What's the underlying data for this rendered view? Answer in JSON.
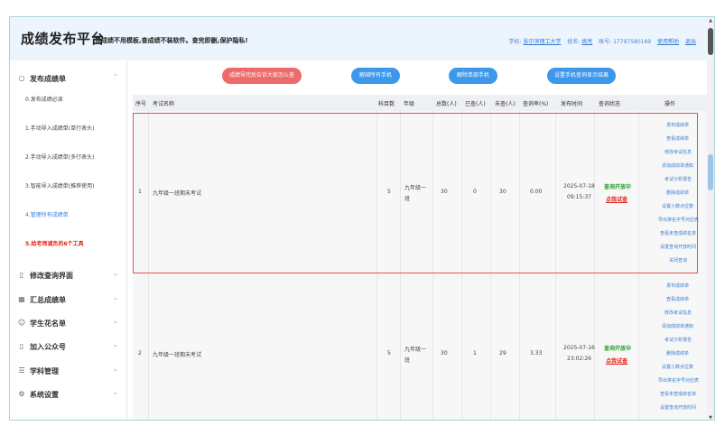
{
  "header": {
    "title": "成绩发布平台",
    "slogan": "导成绩不用模板,查成绩不装软件。查完即删,保护隐私!",
    "school_label": "学校:",
    "school_value": "张尔滨理工大学",
    "name_label": "姓名:",
    "name_value": "姚亮",
    "account_label": "账号:",
    "account_value": "17797580169",
    "help": "使用帮助",
    "logout": "退出"
  },
  "sidebar": {
    "groups": [
      {
        "label": "发布成绩单",
        "icon": "search-icon",
        "expanded": true
      },
      {
        "label": "修改查询界面",
        "icon": "phone-icon"
      },
      {
        "label": "汇总成绩单",
        "icon": "grid-icon"
      },
      {
        "label": "学生花名单",
        "icon": "user-icon"
      },
      {
        "label": "加入公众号",
        "icon": "phone-icon"
      },
      {
        "label": "学科管理",
        "icon": "list-icon"
      },
      {
        "label": "系统设置",
        "icon": "settings-icon"
      }
    ],
    "items": [
      "0.发布成绩必读",
      "1.手动导入成绩单(单行表头)",
      "2.手动导入成绩单(多行表头)",
      "3.智能导入成绩单(推荐使用)",
      "4.管理所有成绩单",
      "5.给老师减负的6个工具"
    ]
  },
  "toolbar": {
    "btn1": "成绩导完后告诉大家怎么查",
    "btn2": "解绑所有手机",
    "btn3": "解除单部手机",
    "btn4": "设置手机查询显示结果"
  },
  "table": {
    "headers": [
      "序号",
      "考试名称",
      "科目数",
      "年级",
      "总数(人)",
      "已查(人)",
      "未查(人)",
      "查询率(%)",
      "发布时间",
      "查询状态",
      "操作"
    ],
    "rows": [
      {
        "index": "1",
        "name": "九年级一班期末考试",
        "subjects": "5",
        "grade_l1": "九年级一",
        "grade_l2": "班",
        "total": "30",
        "queried": "0",
        "unqueried": "30",
        "rate": "0.00",
        "date": "2025-07-18",
        "time": "09:15:37",
        "status": "查询开放中",
        "status_action": "点我试查"
      },
      {
        "index": "2",
        "name": "九年级一班期末考试",
        "subjects": "5",
        "grade_l1": "九年级一",
        "grade_l2": "班",
        "total": "30",
        "queried": "1",
        "unqueried": "29",
        "rate": "3.33",
        "date": "2025-07-16",
        "time": "23:02:26",
        "status": "查询开放中",
        "status_action": "点我试查"
      }
    ],
    "operations": [
      "发布成绩单",
      "查看成绩单",
      "修改考试信息",
      "添加成绩单通知",
      "考试分析报告",
      "删除成绩单",
      "设置小数点位数",
      "导出排名字号对应表",
      "查看未查成绩名单",
      "设置查询开放时间",
      "关闭查询"
    ]
  }
}
